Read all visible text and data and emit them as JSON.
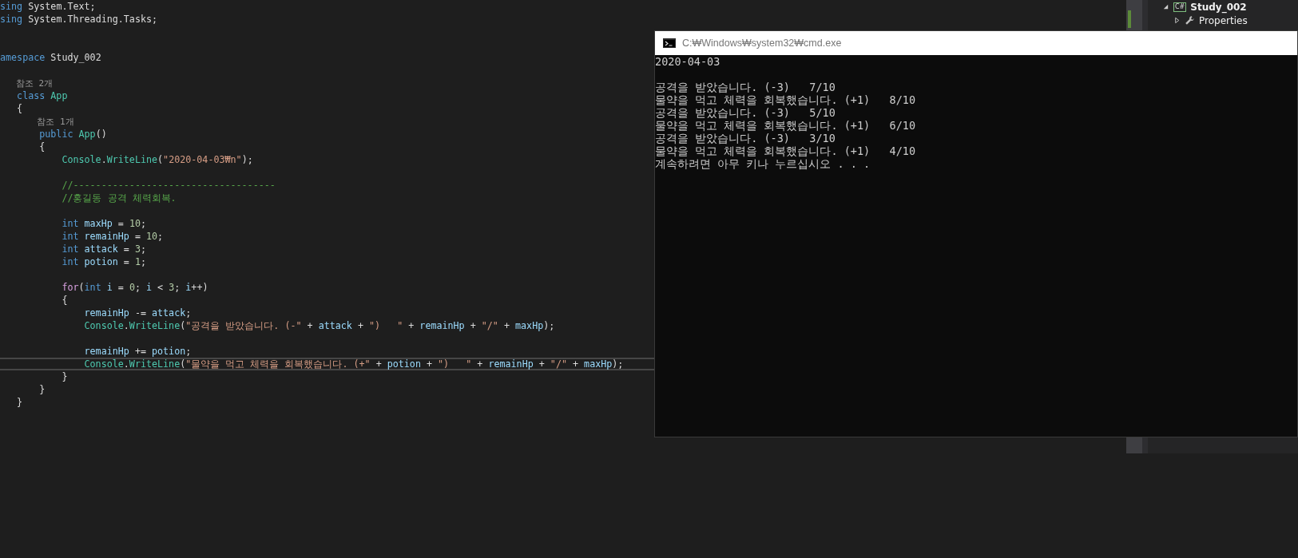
{
  "editor": {
    "lines": [
      {
        "kind": "code",
        "current": false,
        "t": [
          {
            "kind": "keyword",
            "text": "sing"
          },
          {
            "kind": "plain",
            "text": " System.Text;"
          }
        ]
      },
      {
        "kind": "code",
        "current": false,
        "t": [
          {
            "kind": "keyword",
            "text": "sing"
          },
          {
            "kind": "plain",
            "text": " System.Threading.Tasks;"
          }
        ]
      },
      {
        "kind": "blank",
        "current": false
      },
      {
        "kind": "blank",
        "current": false
      },
      {
        "kind": "code",
        "current": false,
        "t": [
          {
            "kind": "keyword",
            "text": "amespace"
          },
          {
            "kind": "plain",
            "text": " Study_002"
          }
        ]
      },
      {
        "kind": "blank",
        "current": false
      },
      {
        "kind": "code",
        "current": false,
        "t": [
          {
            "kind": "codelens",
            "text": "   참조 2개"
          }
        ]
      },
      {
        "kind": "code",
        "current": false,
        "t": [
          {
            "kind": "keyword",
            "text": "   class"
          },
          {
            "kind": "type",
            "text": " App"
          }
        ]
      },
      {
        "kind": "code",
        "current": false,
        "t": [
          {
            "kind": "plain",
            "text": "   {"
          }
        ]
      },
      {
        "kind": "code",
        "current": false,
        "t": [
          {
            "kind": "codelens",
            "text": "       참조 1개"
          }
        ]
      },
      {
        "kind": "code",
        "current": false,
        "t": [
          {
            "kind": "keyword",
            "text": "       public"
          },
          {
            "kind": "type",
            "text": " App"
          },
          {
            "kind": "plain",
            "text": "()"
          }
        ]
      },
      {
        "kind": "code",
        "current": false,
        "t": [
          {
            "kind": "plain",
            "text": "       {"
          }
        ]
      },
      {
        "kind": "code",
        "current": false,
        "t": [
          {
            "kind": "type",
            "text": "           Console"
          },
          {
            "kind": "plain",
            "text": "."
          },
          {
            "kind": "type",
            "text": "WriteLine"
          },
          {
            "kind": "plain",
            "text": "("
          },
          {
            "kind": "string",
            "text": "\"2020-04-03₩n\""
          },
          {
            "kind": "plain",
            "text": ");"
          }
        ]
      },
      {
        "kind": "blank",
        "current": false
      },
      {
        "kind": "code",
        "current": false,
        "t": [
          {
            "kind": "comment",
            "text": "           //------------------------------------"
          }
        ]
      },
      {
        "kind": "code",
        "current": false,
        "t": [
          {
            "kind": "comment",
            "text": "           //홍길동 공격 체력회복."
          }
        ]
      },
      {
        "kind": "blank",
        "current": false
      },
      {
        "kind": "code",
        "current": false,
        "t": [
          {
            "kind": "keyword",
            "text": "           int"
          },
          {
            "kind": "variable",
            "text": " maxHp"
          },
          {
            "kind": "plain",
            "text": " = "
          },
          {
            "kind": "number",
            "text": "10"
          },
          {
            "kind": "plain",
            "text": ";"
          }
        ]
      },
      {
        "kind": "code",
        "current": false,
        "t": [
          {
            "kind": "keyword",
            "text": "           int"
          },
          {
            "kind": "variable",
            "text": " remainHp"
          },
          {
            "kind": "plain",
            "text": " = "
          },
          {
            "kind": "number",
            "text": "10"
          },
          {
            "kind": "plain",
            "text": ";"
          }
        ]
      },
      {
        "kind": "code",
        "current": false,
        "t": [
          {
            "kind": "keyword",
            "text": "           int"
          },
          {
            "kind": "variable",
            "text": " attack"
          },
          {
            "kind": "plain",
            "text": " = "
          },
          {
            "kind": "number",
            "text": "3"
          },
          {
            "kind": "plain",
            "text": ";"
          }
        ]
      },
      {
        "kind": "code",
        "current": false,
        "t": [
          {
            "kind": "keyword",
            "text": "           int"
          },
          {
            "kind": "variable",
            "text": " potion"
          },
          {
            "kind": "plain",
            "text": " = "
          },
          {
            "kind": "number",
            "text": "1"
          },
          {
            "kind": "plain",
            "text": ";"
          }
        ]
      },
      {
        "kind": "blank",
        "current": false
      },
      {
        "kind": "code",
        "current": false,
        "t": [
          {
            "kind": "control",
            "text": "           for"
          },
          {
            "kind": "plain",
            "text": "("
          },
          {
            "kind": "keyword",
            "text": "int"
          },
          {
            "kind": "variable",
            "text": " i"
          },
          {
            "kind": "plain",
            "text": " = "
          },
          {
            "kind": "number",
            "text": "0"
          },
          {
            "kind": "plain",
            "text": ";"
          },
          {
            "kind": "variable",
            "text": " i"
          },
          {
            "kind": "plain",
            "text": " < "
          },
          {
            "kind": "number",
            "text": "3"
          },
          {
            "kind": "plain",
            "text": ";"
          },
          {
            "kind": "variable",
            "text": " i"
          },
          {
            "kind": "plain",
            "text": "++)"
          }
        ]
      },
      {
        "kind": "code",
        "current": false,
        "t": [
          {
            "kind": "plain",
            "text": "           {"
          }
        ]
      },
      {
        "kind": "code",
        "current": false,
        "t": [
          {
            "kind": "variable",
            "text": "               remainHp"
          },
          {
            "kind": "plain",
            "text": " -= "
          },
          {
            "kind": "variable",
            "text": "attack"
          },
          {
            "kind": "plain",
            "text": ";"
          }
        ]
      },
      {
        "kind": "code",
        "current": false,
        "t": [
          {
            "kind": "type",
            "text": "               Console"
          },
          {
            "kind": "plain",
            "text": "."
          },
          {
            "kind": "type",
            "text": "WriteLine"
          },
          {
            "kind": "plain",
            "text": "("
          },
          {
            "kind": "string",
            "text": "\"공격을 받았습니다. (-\""
          },
          {
            "kind": "plain",
            "text": " + "
          },
          {
            "kind": "variable",
            "text": "attack"
          },
          {
            "kind": "plain",
            "text": " + "
          },
          {
            "kind": "string",
            "text": "\")   \""
          },
          {
            "kind": "plain",
            "text": " + "
          },
          {
            "kind": "variable",
            "text": "remainHp"
          },
          {
            "kind": "plain",
            "text": " + "
          },
          {
            "kind": "string",
            "text": "\"/\""
          },
          {
            "kind": "plain",
            "text": " + "
          },
          {
            "kind": "variable",
            "text": "maxHp"
          },
          {
            "kind": "plain",
            "text": ");"
          }
        ]
      },
      {
        "kind": "blank",
        "current": false
      },
      {
        "kind": "code",
        "current": false,
        "t": [
          {
            "kind": "variable",
            "text": "               remainHp"
          },
          {
            "kind": "plain",
            "text": " += "
          },
          {
            "kind": "variable",
            "text": "potion"
          },
          {
            "kind": "plain",
            "text": ";"
          }
        ]
      },
      {
        "kind": "code",
        "current": true,
        "t": [
          {
            "kind": "type",
            "text": "               Console"
          },
          {
            "kind": "plain",
            "text": "."
          },
          {
            "kind": "type",
            "text": "WriteLine"
          },
          {
            "kind": "plain",
            "text": "("
          },
          {
            "kind": "string",
            "text": "\"물약을 먹고 체력을 회복했습니다. (+\""
          },
          {
            "kind": "plain",
            "text": " + "
          },
          {
            "kind": "variable",
            "text": "potion"
          },
          {
            "kind": "plain",
            "text": " + "
          },
          {
            "kind": "string",
            "text": "\")   \""
          },
          {
            "kind": "plain",
            "text": " + "
          },
          {
            "kind": "variable",
            "text": "remainHp"
          },
          {
            "kind": "plain",
            "text": " + "
          },
          {
            "kind": "string",
            "text": "\"/\""
          },
          {
            "kind": "plain",
            "text": " + "
          },
          {
            "kind": "variable",
            "text": "maxHp"
          },
          {
            "kind": "plain",
            "text": ");"
          }
        ]
      },
      {
        "kind": "code",
        "current": false,
        "t": [
          {
            "kind": "plain",
            "text": "           }"
          }
        ]
      },
      {
        "kind": "code",
        "current": false,
        "t": [
          {
            "kind": "plain",
            "text": "       }"
          }
        ]
      },
      {
        "kind": "code",
        "current": false,
        "t": [
          {
            "kind": "plain",
            "text": "   }"
          }
        ]
      }
    ]
  },
  "solution_explorer": {
    "items": [
      {
        "kind": "project",
        "badge": "C#",
        "label": "Study_002",
        "expanded": true
      },
      {
        "kind": "folder",
        "label": "Properties",
        "expanded": false
      }
    ]
  },
  "console_window": {
    "title": "C:₩Windows₩system32₩cmd.exe",
    "output": [
      {
        "kind": "text",
        "text": "2020-04-03"
      },
      {
        "kind": "blank"
      },
      {
        "kind": "text",
        "text": "공격을 받았습니다. (-3)   7/10"
      },
      {
        "kind": "text",
        "text": "물약을 먹고 체력을 회복했습니다. (+1)   8/10"
      },
      {
        "kind": "text",
        "text": "공격을 받았습니다. (-3)   5/10"
      },
      {
        "kind": "text",
        "text": "물약을 먹고 체력을 회복했습니다. (+1)   6/10"
      },
      {
        "kind": "text",
        "text": "공격을 받았습니다. (-3)   3/10"
      },
      {
        "kind": "text",
        "text": "물약을 먹고 체력을 회복했습니다. (+1)   4/10"
      },
      {
        "kind": "text",
        "text": "계속하려면 아무 키나 누르십시오 . . ."
      }
    ]
  }
}
